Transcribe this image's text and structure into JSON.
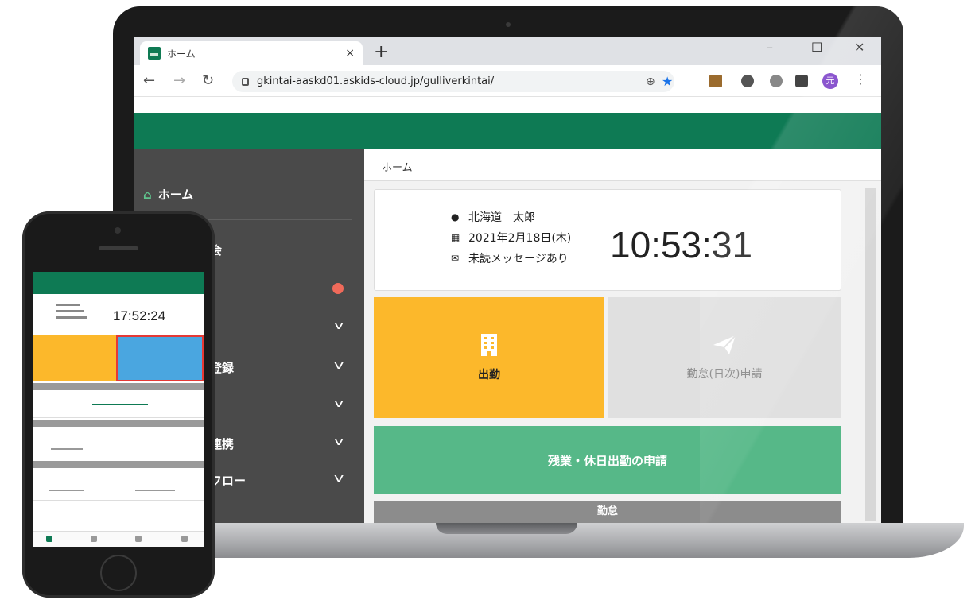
{
  "browser": {
    "tab_title": "ホーム",
    "tab_close": "×",
    "new_tab": "+",
    "window_controls": {
      "minimize": "–",
      "maximize": "☐",
      "close": "✕"
    },
    "url": "gkintai-aaskd01.askids-cloud.jp/gulliverkintai/",
    "profile_initial": "元"
  },
  "sidebar": {
    "items": [
      {
        "label": "ホーム",
        "icon": "home-icon"
      },
      {
        "label": "会"
      },
      {
        "label": "登録"
      },
      {
        "label": "連携"
      },
      {
        "label": "フロー"
      }
    ]
  },
  "main": {
    "breadcrumb": "ホーム",
    "user_name": "北海道　太郎",
    "date": "2021年2月18日(木)",
    "message_status": "未読メッセージあり",
    "clock": "10:53:31",
    "clock_in_label": "出勤",
    "apply_label": "勤怠(日次)申請",
    "overtime_label": "残業・休日出勤の申請",
    "section_label": "勤怠"
  },
  "phone": {
    "clock": "17:52:24"
  },
  "colors": {
    "brand_green": "#0e7a54",
    "clock_in_yellow": "#fcb82b",
    "overtime_green": "#56b888",
    "sidebar_gray": "#4a4a4a"
  }
}
